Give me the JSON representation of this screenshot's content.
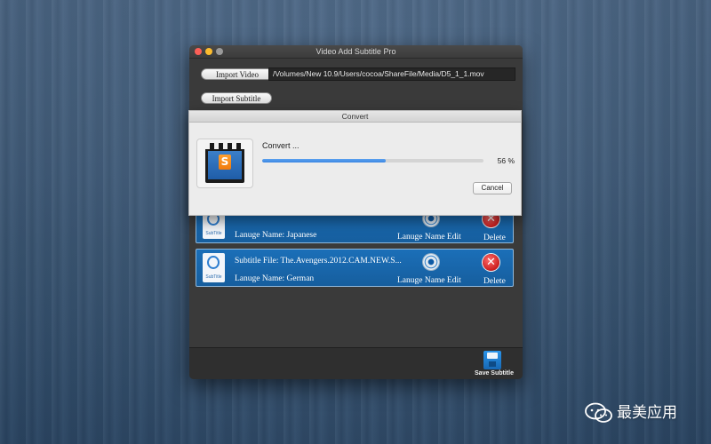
{
  "window": {
    "title": "Video Add Subtitle Pro"
  },
  "toolbar": {
    "import_video_label": "Import Video",
    "import_subtitle_label": "Import Subtitle",
    "video_path": "/Volumes/New 10.9/Users/cocoa/ShareFile/Media/D5_1_1.mov"
  },
  "subtitles": [
    {
      "file": "",
      "language_text": "Lanuge Name: Japanese",
      "edit_label": "Lanuge Name Edit",
      "delete_label": "Delete"
    },
    {
      "file": "Subtitle File:   The.Avengers.2012.CAM.NEW.S...",
      "language_text": "Lanuge Name: German",
      "edit_label": "Lanuge Name Edit",
      "delete_label": "Delete"
    }
  ],
  "file_icon_caption": "SubTitle",
  "footer": {
    "save_label": "Save Subtitle"
  },
  "convert_dialog": {
    "title": "Convert",
    "status": "Convert ...",
    "progress_percent": 56,
    "percent_text": "56 %",
    "cancel_label": "Cancel",
    "app_badge": "S"
  },
  "watermark": {
    "text": "最美应用",
    "logo": "wechat-logo-icon"
  },
  "colors": {
    "accent_blue": "#1b6fb8",
    "progress_blue": "#3b86e2",
    "delete_red": "#cc1f1f"
  }
}
